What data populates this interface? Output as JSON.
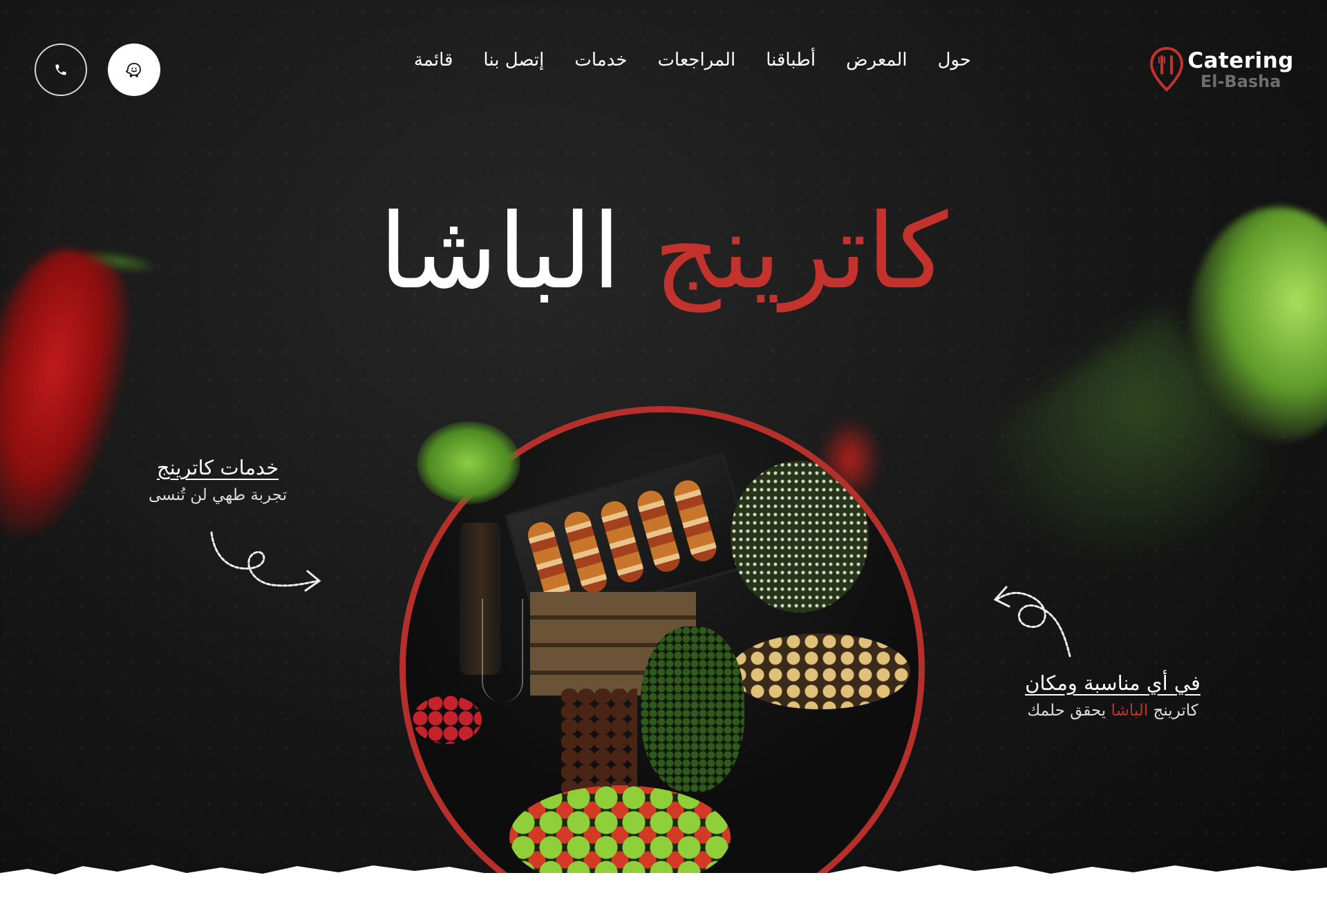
{
  "brand": {
    "name": "Catering",
    "sub": "El-Basha",
    "accent_color": "#c2332d"
  },
  "nav": {
    "items": [
      "حول",
      "المعرض",
      "أطباقنا",
      "المراجعات",
      "خدمات",
      "إتصل بنا",
      "قائمة"
    ]
  },
  "header_buttons": {
    "waze_icon": "waze-icon",
    "phone_icon": "phone-icon"
  },
  "hero": {
    "title_red": "كاترينج",
    "title_white": "الباشا"
  },
  "caption_left": {
    "title": "خدمات كاترينج",
    "subtitle": "تجربة طهي لن تُنسى"
  },
  "caption_right": {
    "title": "في أي مناسبة ومكان",
    "subtitle_before": "كاترينج",
    "subtitle_accent": "الباشا",
    "subtitle_after": "يحقق حلمك"
  },
  "colors": {
    "background": "#141414",
    "accent": "#c2332d",
    "paper": "#ffffff"
  }
}
